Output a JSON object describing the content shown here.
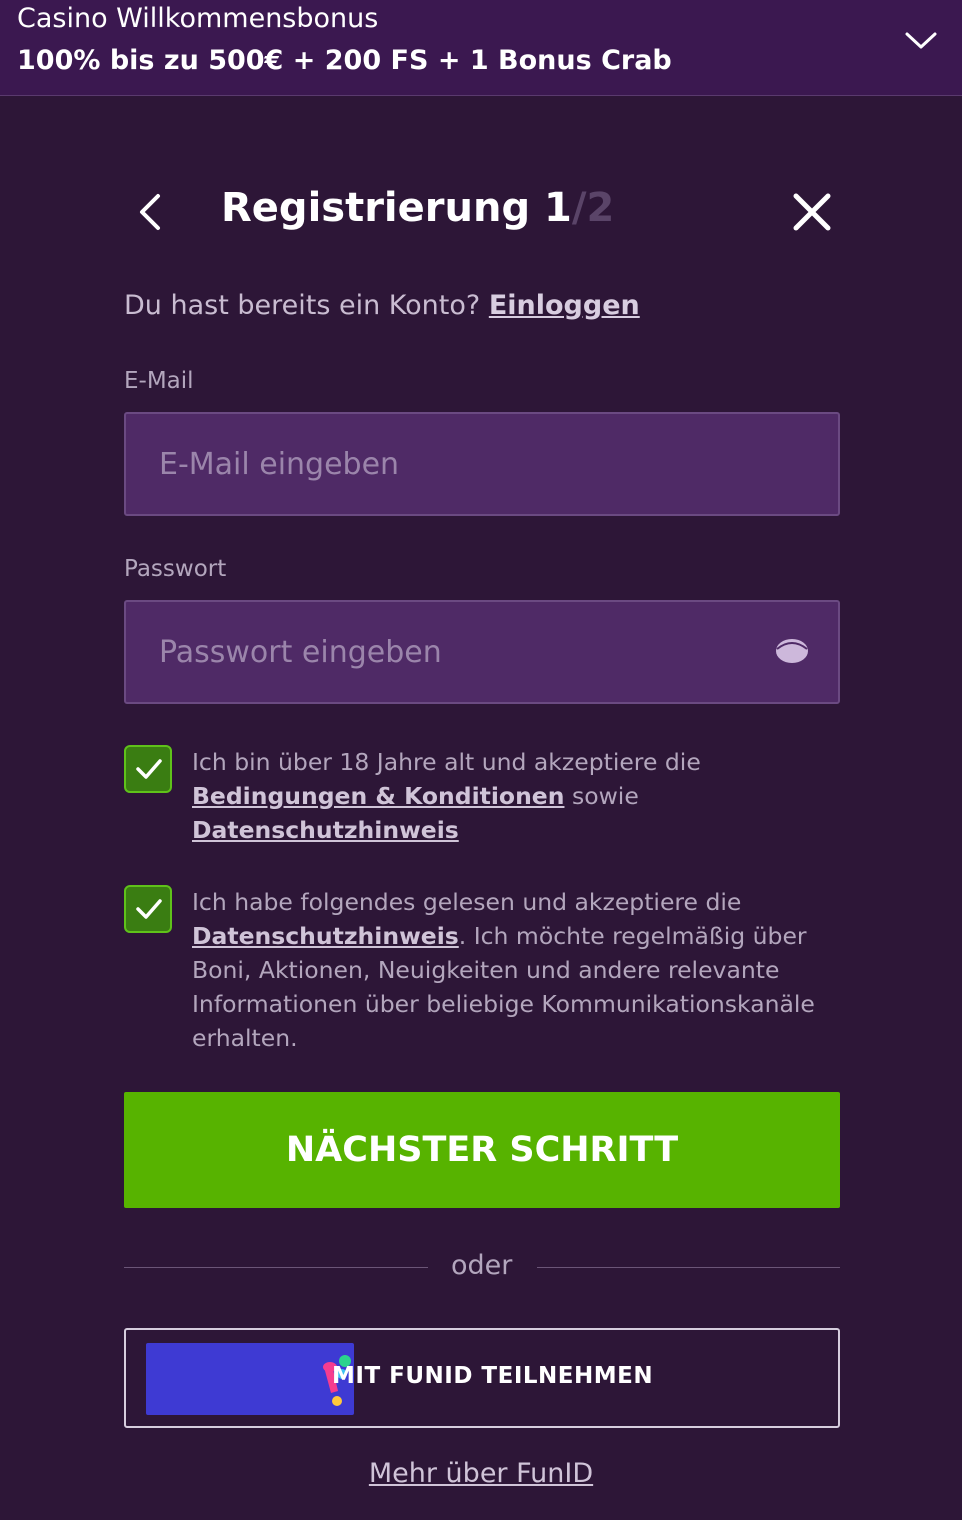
{
  "banner": {
    "title": "Casino Willkommensbonus",
    "offer": "100% bis zu 500€ + 200 FS + 1 Bonus Crab",
    "toggle_icon": "chevron-down-icon"
  },
  "registration": {
    "title": "Registrierung",
    "step_current": "1",
    "step_separator": "/",
    "step_total": "2",
    "back_icon": "chevron-left-icon",
    "close_icon": "close-icon"
  },
  "login_prompt": {
    "text": "Du hast bereits ein Konto?",
    "link": "Einloggen"
  },
  "email": {
    "label": "E-Mail",
    "placeholder": "E-Mail eingeben",
    "value": ""
  },
  "password": {
    "label": "Passwort",
    "placeholder": "Passwort eingeben",
    "value": "",
    "toggle_icon": "eye-icon"
  },
  "consents": [
    {
      "checked": true,
      "text_before": "Ich bin über 18 Jahre alt und akzeptiere die",
      "link1": "Bedingungen & Konditionen",
      "text_middle": "sowie",
      "link2": "Datenschutzhinweis"
    },
    {
      "checked": true,
      "text_before": "Ich habe folgendes gelesen und akzeptiere die",
      "link": "Datenschutzhinweis",
      "text_after": ". Ich möchte regelmäßig über Boni, Aktionen, Neuigkeiten und andere relevante Informationen über beliebige Kommunikationskanäle erhalten."
    }
  ],
  "next_button": "NÄCHSTER SCHRITT",
  "divider": "oder",
  "funid": {
    "button_label": "MIT FUNID TEILNEHMEN",
    "more_link": "Mehr über FunID",
    "logo_icon": "funid-logo-icon"
  },
  "colors": {
    "background": "#2d1637",
    "banner": "#3b1850",
    "input": "#4f2a66",
    "accent_green": "#57b300",
    "funid_blue": "#3e3ad3"
  }
}
